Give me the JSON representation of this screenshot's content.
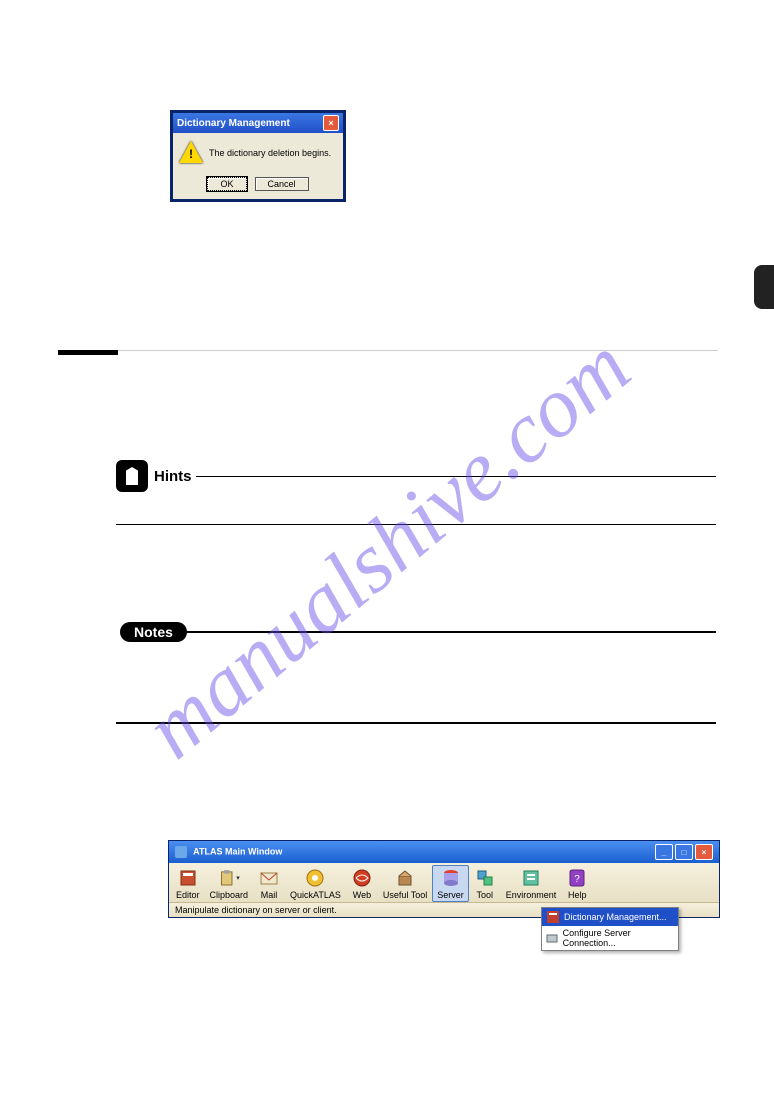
{
  "dialog1": {
    "title": "Dictionary Management",
    "message": "The dictionary deletion begins.",
    "ok": "OK",
    "cancel": "Cancel"
  },
  "hints_label": "Hints",
  "notes_label": "Notes",
  "atlas": {
    "title": "ATLAS Main Window",
    "status": "Manipulate dictionary on server or client.",
    "buttons": [
      "Editor",
      "Clipboard",
      "Mail",
      "QuickATLAS",
      "Web",
      "Useful Tool",
      "Server",
      "Tool",
      "Environment",
      "Help"
    ],
    "menu": {
      "items": [
        "Dictionary Management...",
        "Configure Server Connection..."
      ]
    }
  },
  "watermark": "manualshive.com"
}
